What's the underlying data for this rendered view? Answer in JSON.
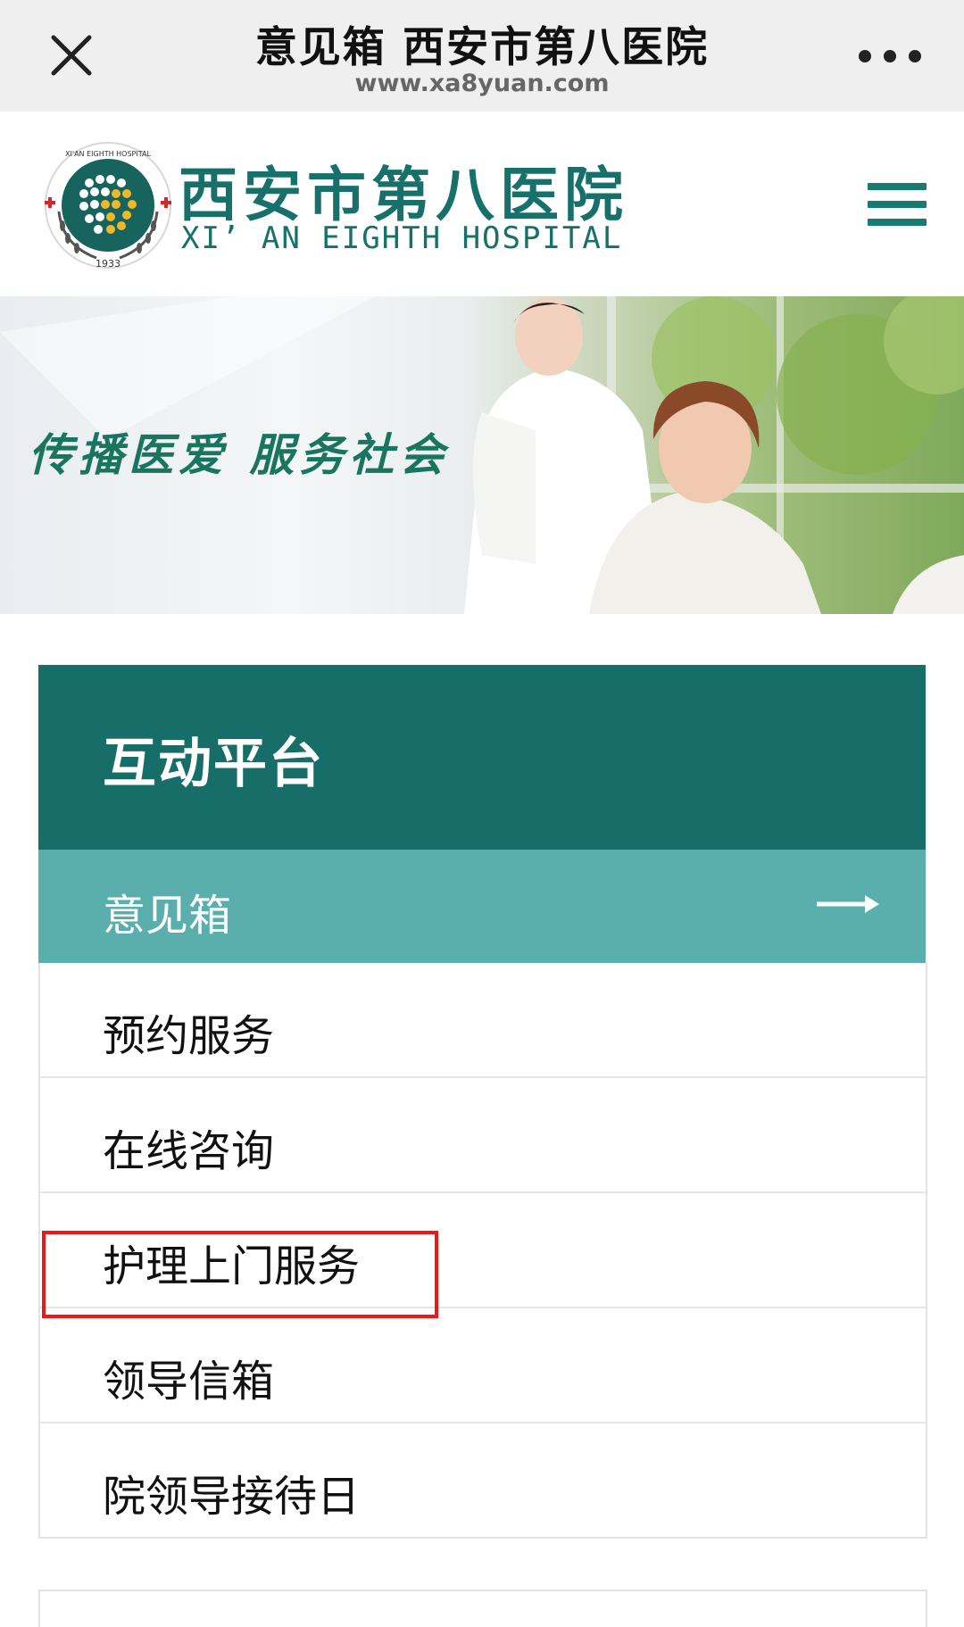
{
  "topbar": {
    "title": "意见箱 西安市第八医院",
    "url": "www.xa8yuan.com",
    "close_icon": "close-icon",
    "more_icon": "more-dots-icon"
  },
  "header": {
    "logo_cn": "西安市第八医院",
    "logo_en": "XI’ AN EIGHTH HOSPITAL",
    "emblem_text": "XI'AN EIGHTH HOSPITAL",
    "emblem_year": "1933",
    "menu_icon": "hamburger-menu-icon"
  },
  "banner": {
    "slogan": "传播医爱 服务社会"
  },
  "platform": {
    "title": "互动平台",
    "active_item": "意见箱",
    "items": [
      {
        "label": "预约服务"
      },
      {
        "label": "在线咨询"
      },
      {
        "label": "护理上门服务"
      },
      {
        "label": "领导信箱"
      },
      {
        "label": "院领导接待日"
      }
    ]
  },
  "colors": {
    "brand_dark": "#176e69",
    "brand_light": "#5aaeab",
    "highlight": "#e21b1b"
  }
}
